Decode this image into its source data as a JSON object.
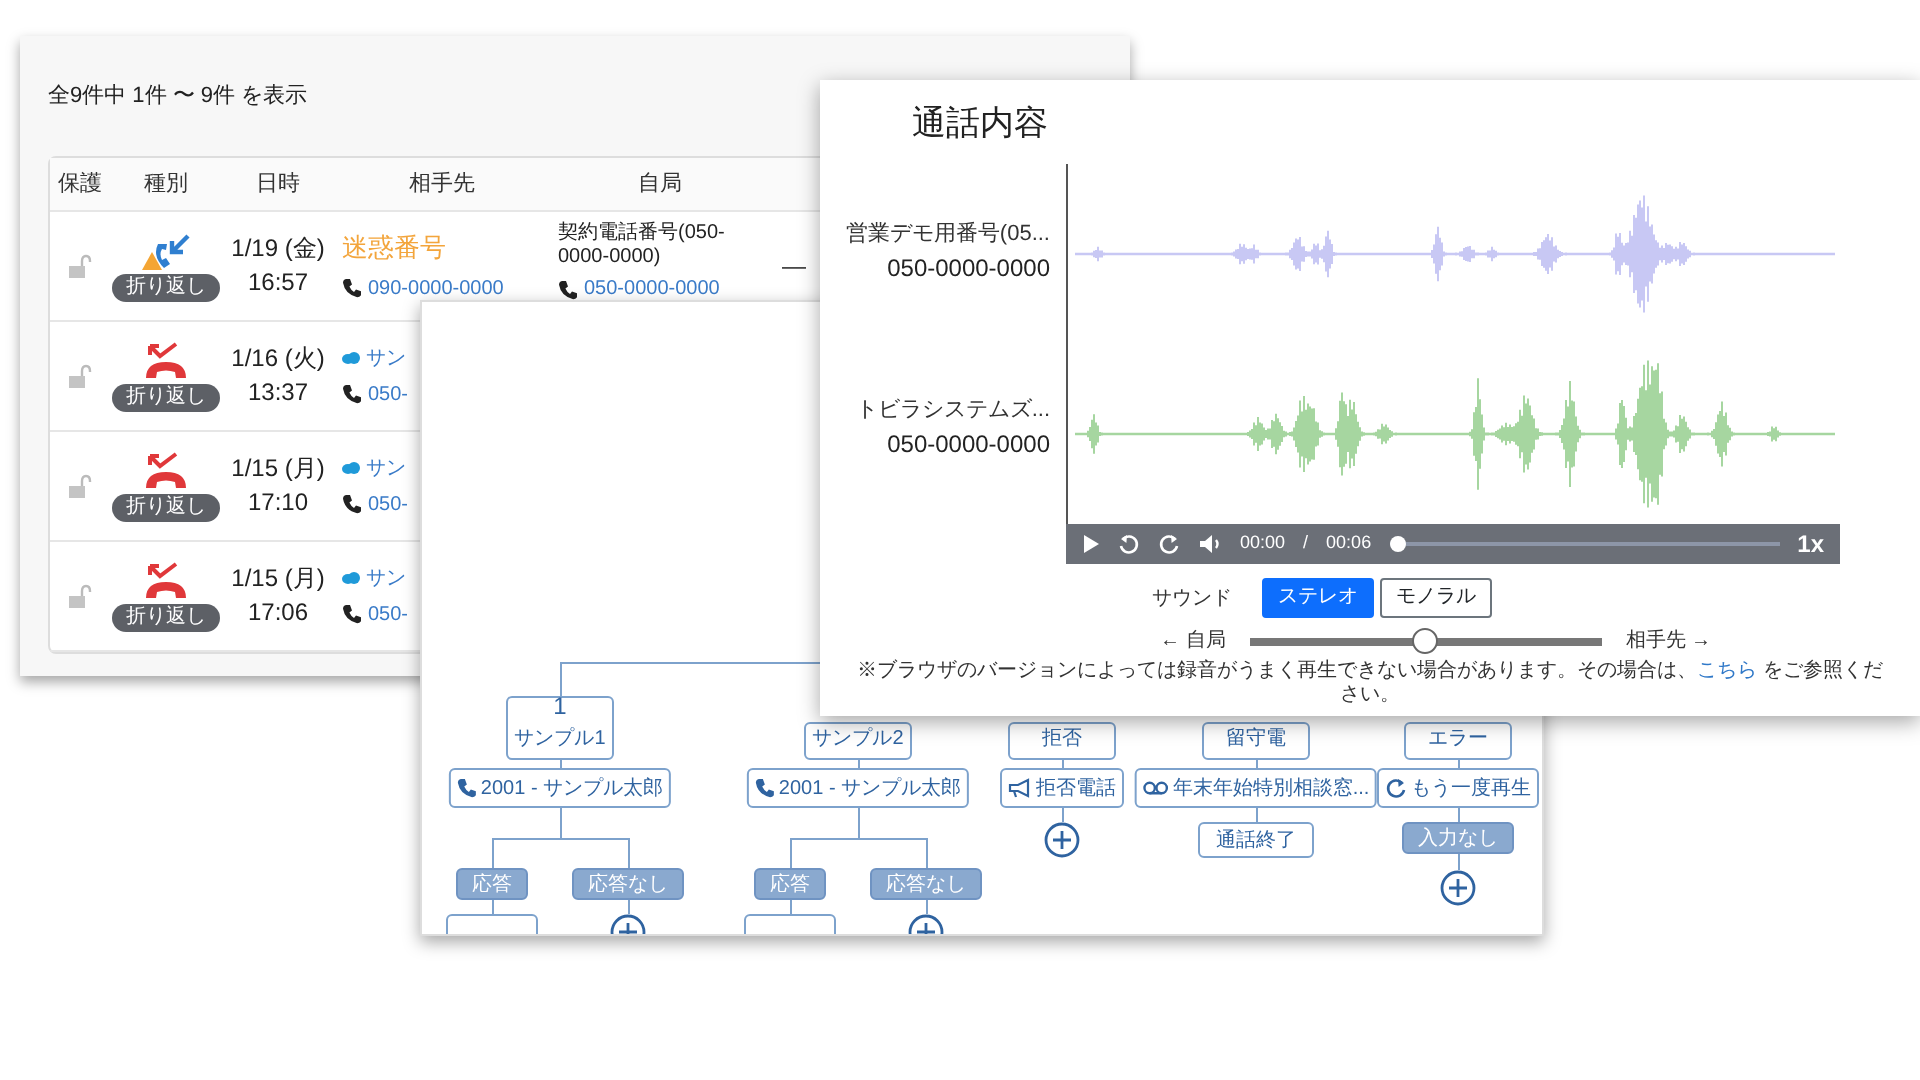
{
  "call_log": {
    "summary": "全9件中 1件 〜 9件 を表示",
    "columns": [
      "保護",
      "種別",
      "日時",
      "相手先",
      "自局"
    ],
    "rows": [
      {
        "protected": false,
        "kind": "incoming_warning",
        "badge": "折り返し",
        "date": "1/19 (金)",
        "time": "16:57",
        "party": {
          "kind": "spam",
          "label": "迷惑番号",
          "phone": "090-0000-0000"
        },
        "own": {
          "name": "契約電話番号(050-0000-0000)",
          "phone": "050-0000-0000"
        },
        "column_6": "—"
      },
      {
        "protected": false,
        "kind": "missed",
        "badge": "折り返し",
        "date": "1/16 (火)",
        "time": "13:37",
        "party": {
          "kind": "contact",
          "label": "サン",
          "phone": "050-"
        }
      },
      {
        "protected": false,
        "kind": "missed",
        "badge": "折り返し",
        "date": "1/15 (月)",
        "time": "17:10",
        "party": {
          "kind": "contact",
          "label": "サン",
          "phone": "050-"
        }
      },
      {
        "protected": false,
        "kind": "missed",
        "badge": "折り返し",
        "date": "1/15 (月)",
        "time": "17:06",
        "party": {
          "kind": "contact",
          "label": "サン",
          "phone": "050-"
        }
      }
    ]
  },
  "flow": {
    "branches": [
      {
        "number": "1",
        "label": "サンプル1",
        "action": {
          "kind": "phone",
          "text": "2001 - サンプル太郎"
        },
        "children": [
          {
            "kind": "branch",
            "text": "応答",
            "next": {
              "kind": "node"
            }
          },
          {
            "kind": "branch",
            "text": "応答なし",
            "next": {
              "kind": "add"
            }
          }
        ]
      },
      {
        "label": "サンプル2",
        "action": {
          "kind": "phone",
          "text": "2001 - サンプル太郎"
        },
        "children": [
          {
            "kind": "branch",
            "text": "応答",
            "next": {
              "kind": "node"
            }
          },
          {
            "kind": "branch",
            "text": "応答なし",
            "next": {
              "kind": "add"
            }
          }
        ]
      },
      {
        "label": "拒否",
        "action": {
          "kind": "megaphone",
          "text": "拒否電話"
        },
        "children": [
          {
            "kind": "add"
          }
        ]
      },
      {
        "label": "留守電",
        "action": {
          "kind": "voicemail",
          "text": "年末年始特別相談窓..."
        },
        "children": [
          {
            "kind": "end",
            "text": "通話終了"
          }
        ]
      },
      {
        "label": "エラー",
        "action": {
          "kind": "replay",
          "text": "もう一度再生"
        },
        "children": [
          {
            "kind": "branch",
            "text": "入力なし",
            "next": {
              "kind": "add"
            }
          }
        ]
      }
    ]
  },
  "call_detail": {
    "title": "通話内容",
    "tracks": [
      {
        "name": "営業デモ用番号(05...",
        "number": "050-0000-0000",
        "color": "#c8c8f4"
      },
      {
        "name": "トビラシステムズ...",
        "number": "050-0000-0000",
        "color": "#a6d6a0"
      }
    ],
    "player": {
      "current": "00:00",
      "separator": "/",
      "duration": "00:06",
      "level": 0,
      "speed": "1x"
    },
    "sound": {
      "label": "サウンド",
      "options": [
        {
          "text": "ステレオ",
          "selected": true
        },
        {
          "text": "モノラル",
          "selected": false
        }
      ]
    },
    "balance": {
      "left": "← 自局",
      "right": "相手先 →",
      "level": 0.5
    },
    "note": {
      "text": "※ブラウザのバージョンによっては録音がうまく再生できない場合があります。その場合は、",
      "link": "こちら",
      "end": " をご参照ください。"
    }
  }
}
